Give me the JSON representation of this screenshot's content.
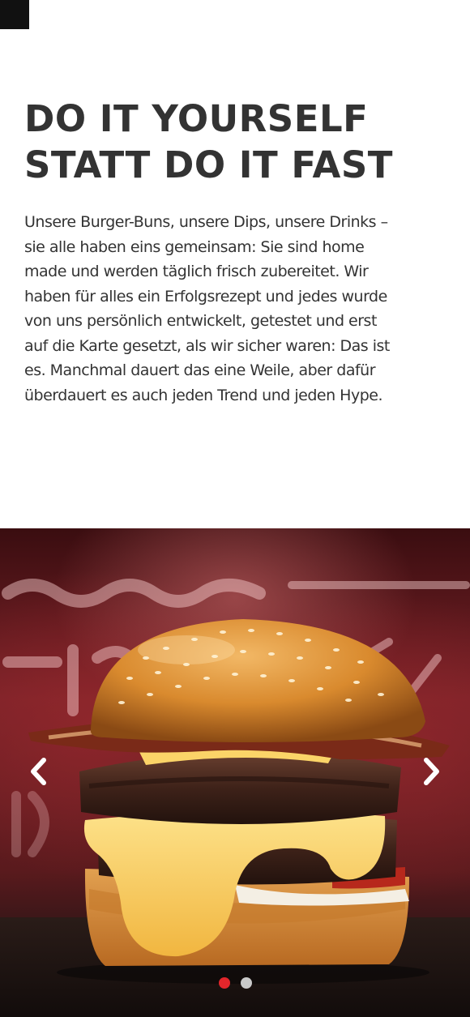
{
  "intro": {
    "headline_lines": [
      "DO IT YOURSELF",
      "STATT DO IT FAST"
    ],
    "body_lines": [
      "Unsere Burger-Buns, unsere Dips, unsere Drinks –",
      "sie alle haben eins gemeinsam: Sie sind home",
      "made und werden täglich frisch zubereitet. Wir",
      "haben für alles ein Erfolgsrezept und jedes wurde",
      "von uns persönlich entwickelt, getestet und erst",
      "auf die Karte gesetzt, als wir sicher waren: Das ist",
      "es. Manchmal dauert das eine Weile, aber dafür",
      "überdauert es auch jeden Trend und jeden Hype."
    ]
  },
  "slider": {
    "prev_icon": "chevron-left-icon",
    "next_icon": "chevron-right-icon",
    "active_index": 0,
    "slide_count": 2,
    "dot_colors": {
      "active": "#e3262b",
      "inactive": "#c9c9c9"
    }
  },
  "colors": {
    "text": "#333333",
    "corner_block": "#111111",
    "arrow": "#ffffff"
  }
}
